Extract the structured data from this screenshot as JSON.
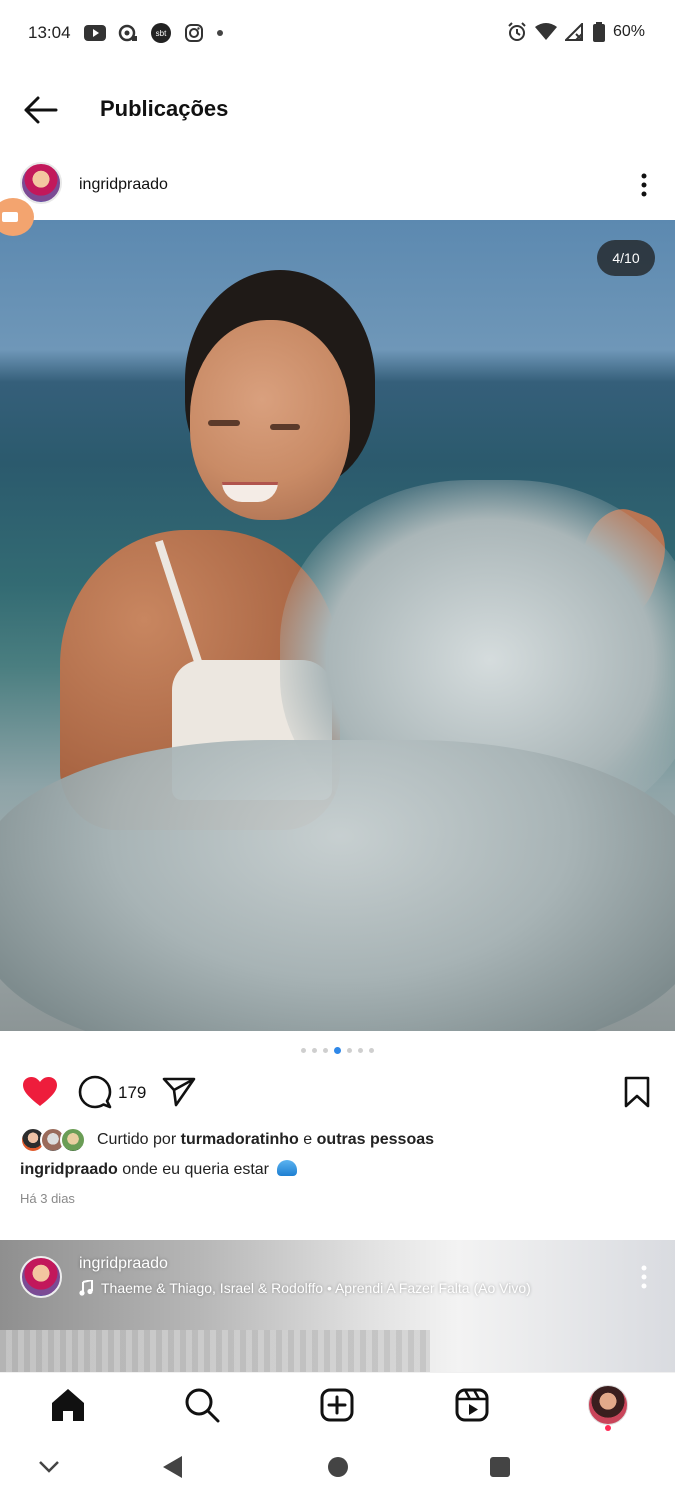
{
  "status_bar": {
    "time": "13:04",
    "battery": "60%",
    "left_icons": [
      "youtube-icon",
      "podcast-icon",
      "sbt-app-icon",
      "instagram-icon",
      "dot-icon"
    ],
    "right_icons": [
      "alarm-icon",
      "wifi-icon",
      "no-signal-icon",
      "battery-icon"
    ]
  },
  "header": {
    "title": "Publicações"
  },
  "post": {
    "username": "ingridpraado",
    "counter": "4/10",
    "carousel": {
      "total": 7,
      "active_index": 3
    },
    "comment_count": "179",
    "liked": true,
    "likes_prefix": "Curtido por",
    "likes_user": "turmadoratinho",
    "likes_connector": "e",
    "likes_suffix": "outras pessoas",
    "caption_user": "ingridpraado",
    "caption_text": "onde eu queria estar",
    "caption_emoji": "wave-emoji",
    "timestamp": "Há 3 dias"
  },
  "next_post": {
    "username": "ingridpraado",
    "music": "Thaeme & Thiago, Israel & Rodolffo • Aprendi A Fazer Falta (Ao Vivo)"
  },
  "bottom_nav": [
    "home-icon",
    "search-icon",
    "create-icon",
    "reels-icon",
    "profile-avatar"
  ],
  "colors": {
    "like_red": "#ee1d3c",
    "active_dot": "#2f88e8",
    "video_bubble": "#f3a46f",
    "profile_dot": "#ff2a55"
  }
}
